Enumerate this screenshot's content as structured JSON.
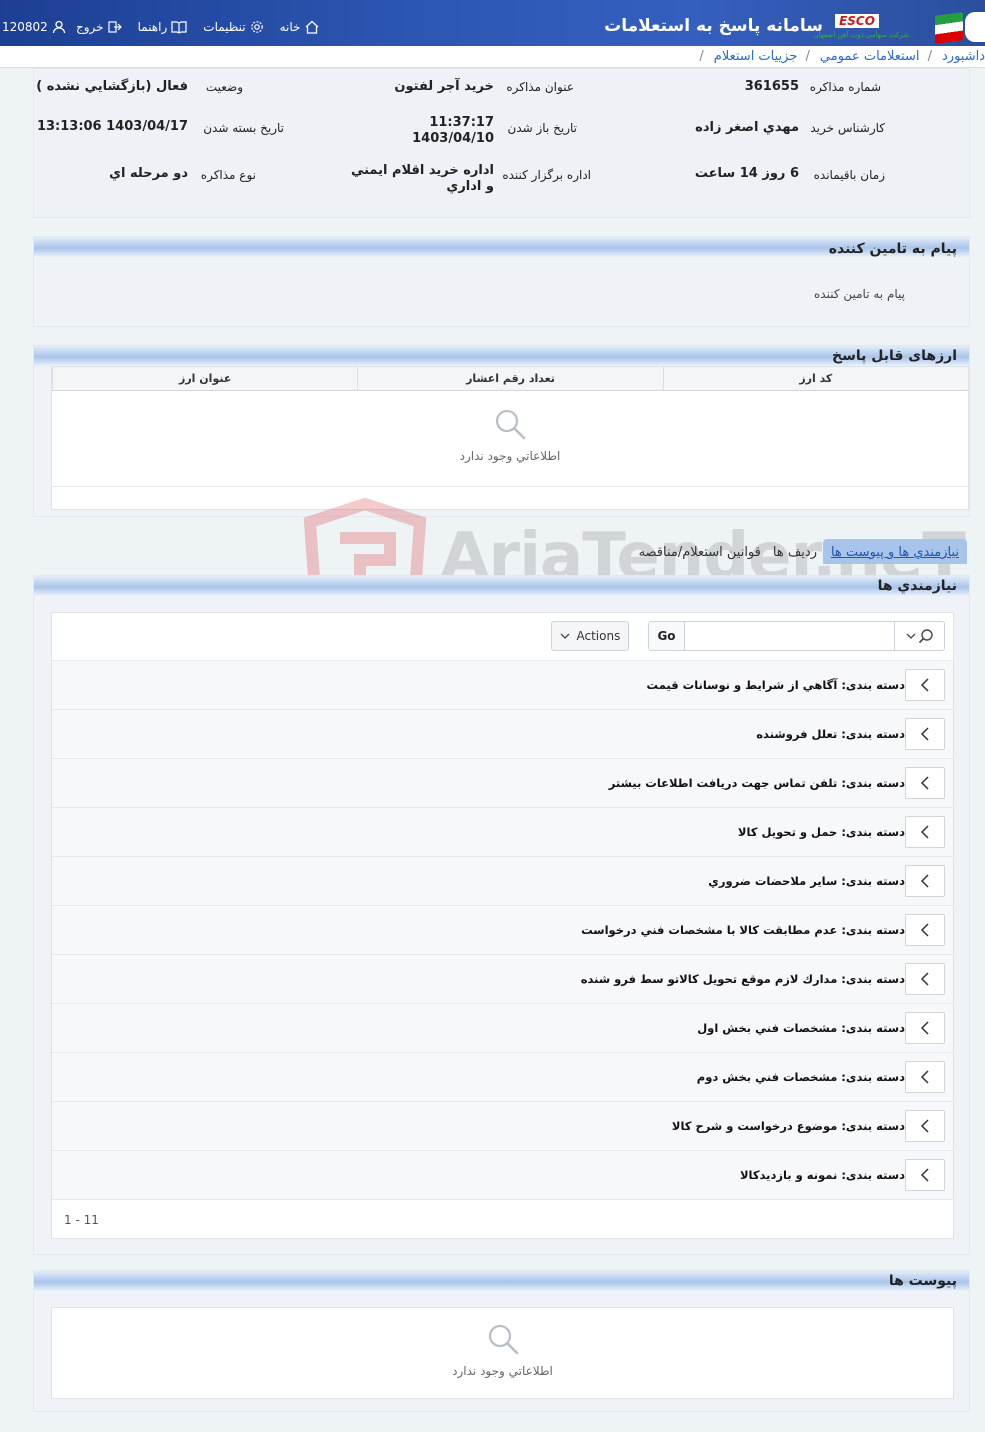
{
  "header": {
    "title": "سامانه پاسخ به استعلامات",
    "logo_text": "ESCO",
    "logo_subtitle": "شرکت سهامی ذوب آهن اصفهان",
    "user_id": "120802",
    "nav": {
      "logout": "خروج",
      "help": "راهنما",
      "settings": "تنظیمات",
      "home": "خانه"
    }
  },
  "breadcrumb": [
    "داشبورد",
    "استعلامات عمومي",
    "جزييات استعلام"
  ],
  "info": {
    "number_label": "شماره مذاکره",
    "number_value": "361655",
    "subject_label": "عنوان مذاكره",
    "subject_value": "خريد آجر لفتون",
    "status_label": "وضعيت",
    "status_value": "فعال (بازگشايي نشده )",
    "expert_label": "كارشناس خريد",
    "expert_value": "مهدي اصغر زاده",
    "open_label": "تاريخ باز شدن",
    "open_time": "11:37:17",
    "open_date": "1403/04/10",
    "close_label": "تاريخ بسته شدن",
    "close_value": "1403/04/17 13:13:06",
    "remaining_label": "زمان باقيمانده",
    "remaining_value": "6 روز 14 ساعت",
    "org_label": "اداره برگزار كننده",
    "org_value_1": "اداره خريد اقلام ايمني",
    "org_value_2": "و اداري",
    "type_label": "نوع مذاكره",
    "type_value": "دو مرحله اي"
  },
  "message_section": {
    "title": "پيام به تامين كننده",
    "body": "پيام به تامين كننده"
  },
  "currency_section": {
    "title": "ارزهای قابل پاسخ",
    "columns": [
      "كد ارز",
      "تعداد رقم اعشار",
      "عنوان ارز"
    ],
    "empty_text": "اطلاعاتي وجود ندارد"
  },
  "tabs": [
    "نيازمندي ها و پيوست ها",
    "رديف ها",
    "قوانين استعلام/مناقصه"
  ],
  "requirements": {
    "title": "نيازمندي ها",
    "go_label": "Go",
    "actions_label": "Actions",
    "search_value": "",
    "items": [
      "دسته بندی: آگاهي از شرايط و نوسانات قيمت",
      "دسته بندی: تعلل فروشنده",
      "دسته بندی: تلفن تماس جهت دريافت اطلاعات بيشتر",
      "دسته بندی: حمل و تحويل كالا",
      "دسته بندی: ساير ملاحضات ضروري",
      "دسته بندی: عدم مطابقت كالا با مشخصات فني درخواست",
      "دسته بندی: مدارك لازم موقع تحويل كالاتو سط فرو شنده",
      "دسته بندی: مشخصات فني بخش اول",
      "دسته بندی: مشخصات فني بخش دوم",
      "دسته بندی: موضوع درخواست و شرح كالا",
      "دسته بندی: نمونه و بازديدكالا"
    ],
    "pager": "1 - 11"
  },
  "attachments": {
    "title": "پيوست ها",
    "empty_text": "اطلاعاتي وجود ندارد"
  },
  "watermark_text": "AriaTender.neT",
  "colors": {
    "topbar": "#2c58b4",
    "accent": "#a9c4ea",
    "link": "#2a6bc6"
  }
}
